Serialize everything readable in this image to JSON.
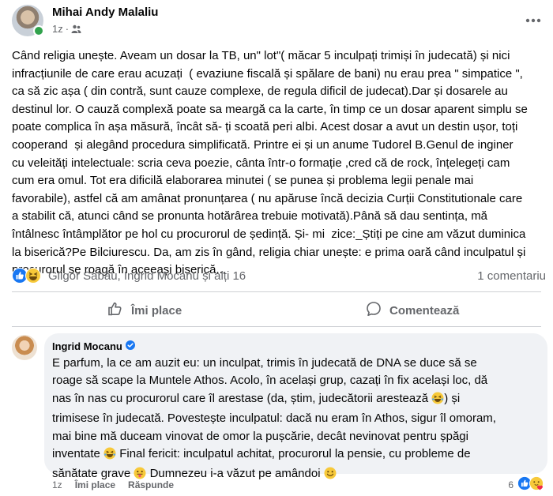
{
  "post": {
    "author": "Mihai Andy Malaliu",
    "time": "1z",
    "audience_icon": "friends-icon",
    "text": "Când religia unește. Aveam un dosar la TB, un\" lot\"( măcar 5 inculpați trimiși în judecată) și nici\ninfracțiunile de care erau acuzați  ( evaziune fiscală și spălare de bani) nu erau prea \" simpatice \",\nca să zic așa ( din contră, sunt cauze complexe, de regula dificil de judecat).Dar și dosarele au\ndestinul lor. O cauză complexă poate sa meargă ca la carte, în timp ce un dosar aparent simplu se\npoate complica în așa măsură, încât să- ți scoată peri albi. Acest dosar a avut un destin ușor, toți\ncooperand  și alegând procedura simplificată. Printre ei și un anume Tudorel B.Genul de inginer\ncu veleități intelectuale: scria ceva poezie, cânta într-o formație ,cred că de rock, înțelegeți cam\ncum era omul. Tot era dificilă elaborarea minutei ( se punea și problema legii penale mai\nfavorabile), astfel că am amânat pronunțarea ( nu apăruse încă decizia Curții Constitutionale care\na stabilit că, atunci când se pronunta hotărârea trebuie motivată).Până să dau sentința, mă\nîntâlnesc întâmplător pe hol cu procurorul de ședință. Și- mi  zice:_Știți pe cine am văzut duminica\nla biserică?Pe Bilciurescu. Da, am zis în gând, religia chiar unește: e prima oară când inculpatul și\nprocurorul se roagă în aceeași biserică..."
  },
  "reactions": {
    "reactors": "Gligor Sabău, Ingrid Mocanu și alți 16",
    "comments_count": "1 comentariu"
  },
  "actions": {
    "like_label": "Îmi place",
    "comment_label": "Comentează"
  },
  "comment": {
    "author": "Ingrid Mocanu",
    "verified_icon": "verified-badge-icon",
    "lines": {
      "l1": "E parfum, la ce am auzit eu: un inculpat, trimis în judecată de DNA se duce să se\nroage să scape la Muntele Athos. Acolo, în același grup, cazați în fix același loc, dă\nnas în nas cu procurorul care îl arestase (da, știm, judecătorii arestează ",
      "l2": ") și\ntrimisese în judecată. Povestește inculpatul: dacă nu eram în Athos, sigur îl omoram,\nmai bine mă duceam vinovat de omor la pușcărie, decât nevinovat pentru șpăgi\ninventate ",
      "l3": " Final fericit: inculpatul achitat, procurorul la pensie, cu probleme de\nsănătate grave ",
      "l4": " Dumnezeu i-a văzut pe amândoi "
    },
    "time": "1z",
    "like_label": "Îmi place",
    "reply_label": "Răspunde",
    "reaction_count": "6"
  },
  "colors": {
    "accent": "#1877f2",
    "secondary_text": "#65676b",
    "bubble": "#f0f2f5",
    "online": "#31a24c"
  }
}
